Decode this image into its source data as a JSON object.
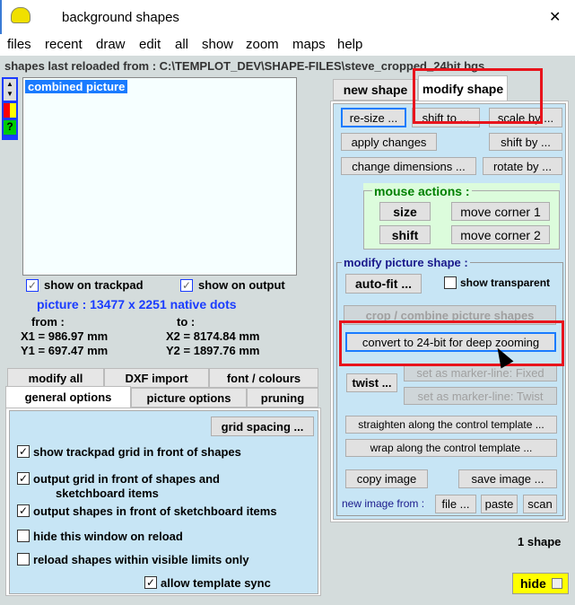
{
  "window": {
    "title": "background  shapes",
    "close": "✕"
  },
  "menu": [
    "files",
    "recent",
    "draw",
    "edit",
    "all",
    "show",
    "zoom",
    "maps",
    "help"
  ],
  "status": "shapes last reloaded from :  C:\\TEMPLOT_DEV\\SHAPE-FILES\\steve_cropped_24bit.bgs",
  "list": {
    "items": [
      "combined picture"
    ]
  },
  "checks": {
    "trackpad": "show  on  trackpad",
    "output": "show  on  output"
  },
  "picture": {
    "info": "picture :  13477  x  2251  native  dots",
    "from": "from :",
    "to": "to :",
    "x1": "X1 =  986.97 mm",
    "y1": "Y1 =  697.47 mm",
    "x2": "X2 =  8174.84 mm",
    "y2": "Y2 =  1897.76 mm"
  },
  "lower_tabs": {
    "row1": [
      "modify  all",
      "DXF  import",
      "font / colours"
    ],
    "row2": [
      "general  options",
      "picture  options",
      "pruning"
    ]
  },
  "options": {
    "grid_spacing": "grid  spacing ...",
    "items": [
      {
        "label": "show  trackpad  grid  in  front  of  shapes",
        "checked": true
      },
      {
        "label": "output  grid  in  front  of  shapes  and",
        "label2": "sketchboard  items",
        "checked": true
      },
      {
        "label": "output  shapes  in  front  of  sketchboard  items",
        "checked": true
      },
      {
        "label": "hide  this  window  on  reload",
        "checked": false
      },
      {
        "label": "reload  shapes  within  visible  limits  only",
        "checked": false
      }
    ],
    "allow_sync": "allow  template  sync"
  },
  "right_tabs": [
    "new  shape",
    "modify  shape"
  ],
  "modify": {
    "resize": "re-size ...",
    "shift_to": "shift  to ...",
    "scale_by": "scale by ...",
    "apply": "apply changes",
    "shift_by": "shift  by ...",
    "change_dim": "change dimensions ...",
    "rotate_by": "rotate  by ...",
    "mouse_title": "mouse  actions :",
    "size": "size",
    "shift": "shift",
    "corner1": "move  corner 1",
    "corner2": "move  corner 2",
    "picture_title": "modify  picture  shape :",
    "autofit": "auto-fit ...",
    "transparent": "show transparent",
    "crop": "crop / combine  picture  shapes",
    "convert": "convert to 24-bit for deep zooming",
    "twist": "twist ...",
    "marker_fixed": "set as marker-line: Fixed",
    "marker_twist": "set as marker-line: Twist",
    "straighten": "straighten along the control template ...",
    "wrap": "wrap along the control template ...",
    "copy": "copy  image",
    "save": "save  image ...",
    "new_from": "new  image from :",
    "file": "file ...",
    "paste": "paste",
    "scan": "scan"
  },
  "count": "1  shape",
  "hide": "hide",
  "colors": {
    "highlight": "#e8141c",
    "accent_blue": "#1a3cff",
    "panel": "#c7e5f5",
    "green_panel": "#dcfcdc",
    "hide_bg": "#ffff00"
  }
}
